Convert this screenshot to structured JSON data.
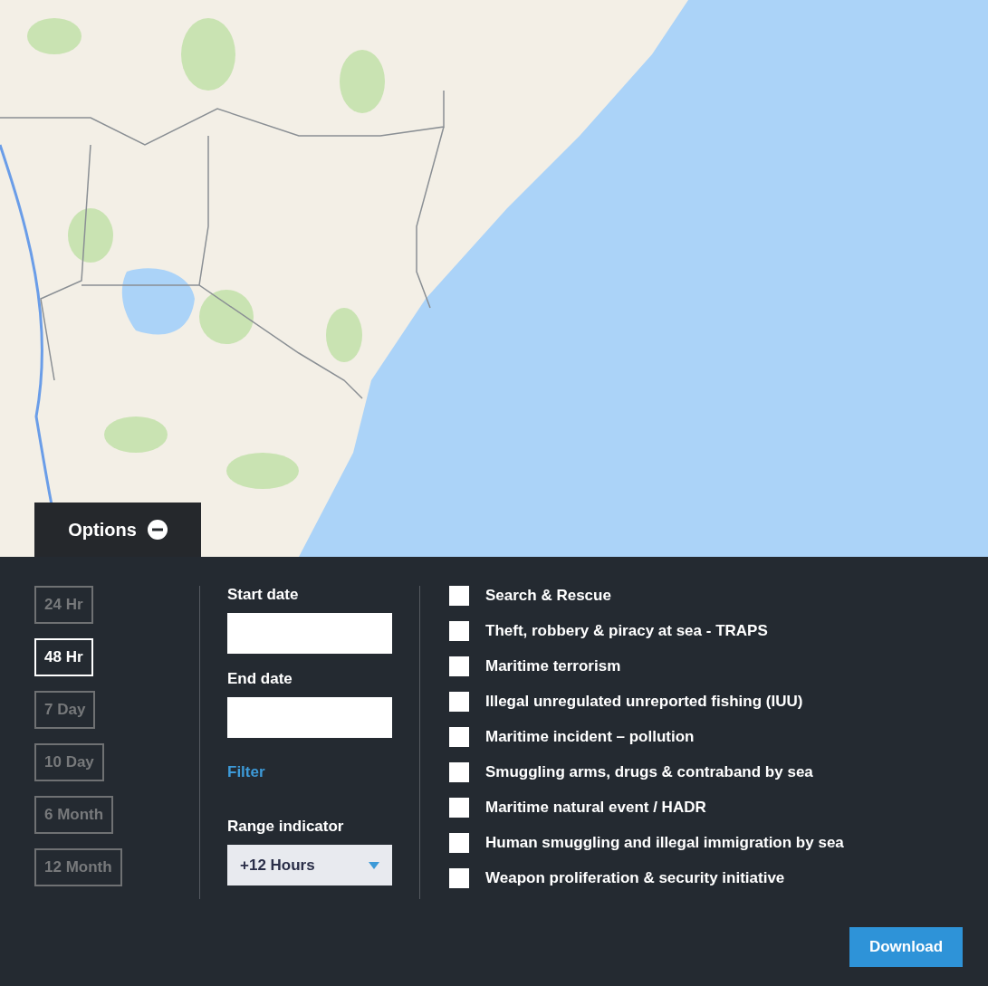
{
  "options_tab": {
    "label": "Options",
    "expanded": true
  },
  "time_ranges": [
    {
      "label": "24 Hr",
      "selected": false
    },
    {
      "label": "48 Hr",
      "selected": true
    },
    {
      "label": "7 Day",
      "selected": false
    },
    {
      "label": "10 Day",
      "selected": false
    },
    {
      "label": "6 Month",
      "selected": false
    },
    {
      "label": "12 Month",
      "selected": false
    }
  ],
  "start_date": {
    "label": "Start date"
  },
  "end_date": {
    "label": "End date"
  },
  "filter_link": "Filter",
  "range_indicator": {
    "label": "Range indicator",
    "value": "+12 Hours"
  },
  "categories": [
    {
      "label": "Search & Rescue",
      "checked": false
    },
    {
      "label": "Theft, robbery & piracy at sea - TRAPS",
      "checked": false
    },
    {
      "label": "Maritime terrorism",
      "checked": false
    },
    {
      "label": "Illegal unregulated unreported fishing (IUU)",
      "checked": false
    },
    {
      "label": "Maritime incident – pollution",
      "checked": false
    },
    {
      "label": "Smuggling arms, drugs & contraband by sea",
      "checked": false
    },
    {
      "label": "Maritime natural event / HADR",
      "checked": false
    },
    {
      "label": "Human smuggling and illegal immigration by sea",
      "checked": false
    },
    {
      "label": "Weapon proliferation & security initiative",
      "checked": false
    }
  ],
  "download_button": "Download"
}
